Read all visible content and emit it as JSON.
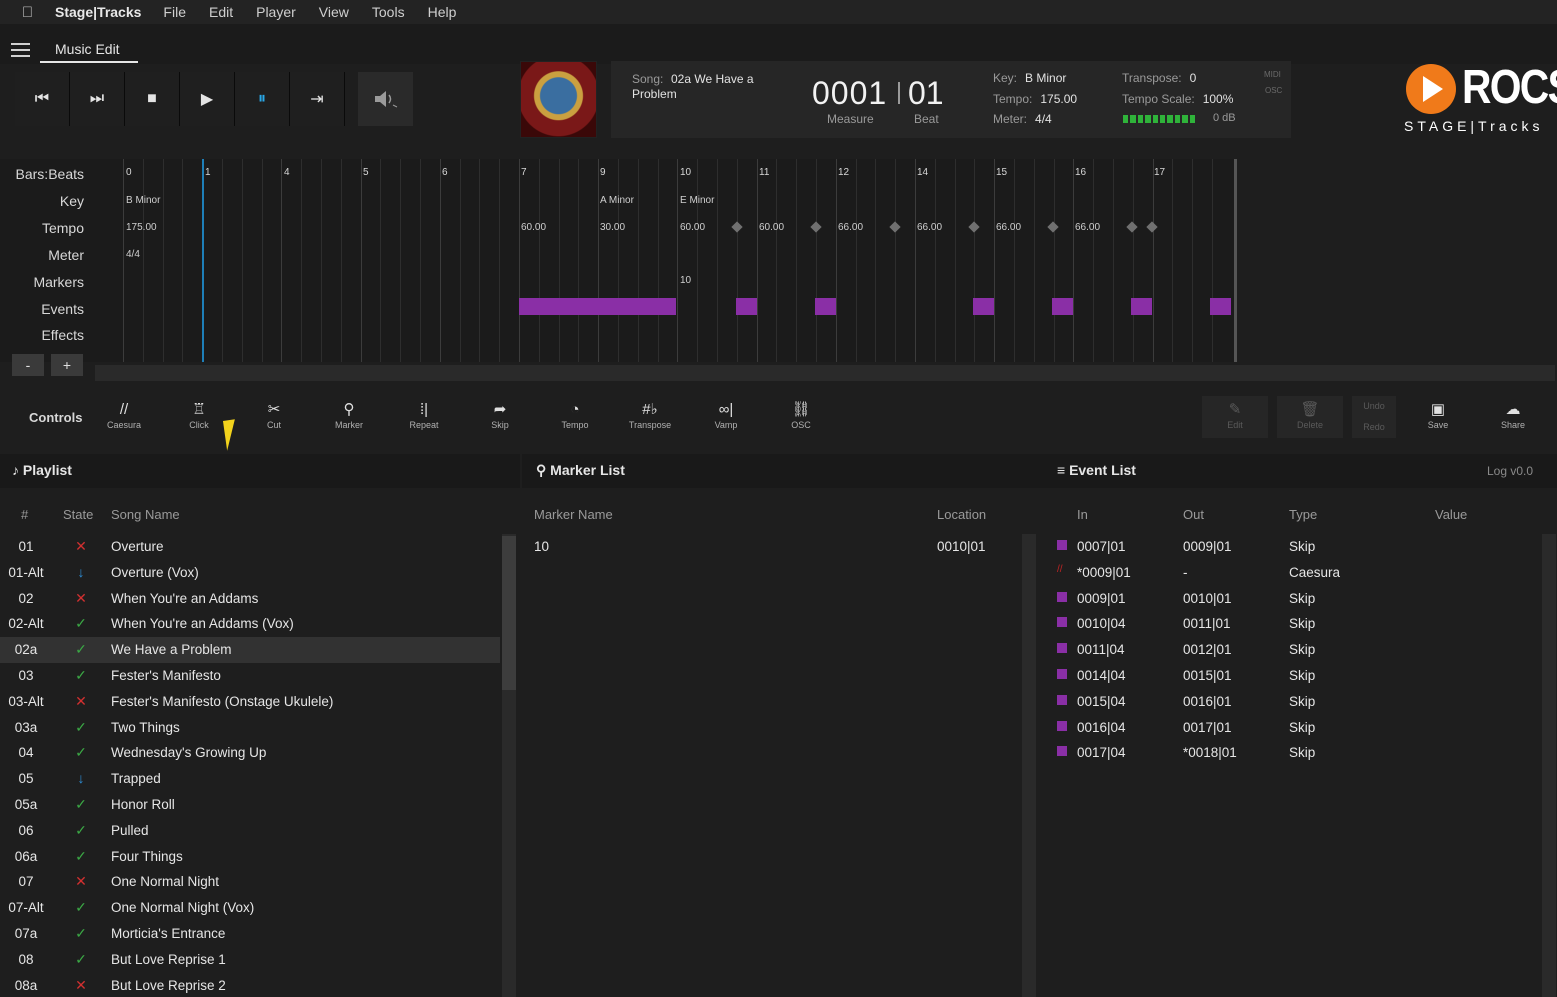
{
  "menubar": {
    "apple": "",
    "app_name": "Stage|Tracks",
    "items": [
      "File",
      "Edit",
      "Player",
      "View",
      "Tools",
      "Help"
    ]
  },
  "tabs": {
    "active": "Music Edit"
  },
  "transport": {
    "buttons": [
      {
        "icon": "skip-back-icon",
        "glyph": "⏮"
      },
      {
        "icon": "next-icon",
        "glyph": "⏭"
      },
      {
        "icon": "stop-icon",
        "glyph": "■"
      },
      {
        "icon": "play-icon",
        "glyph": "▶"
      },
      {
        "icon": "pause-icon",
        "glyph": "⏸"
      },
      {
        "icon": "skip-end-icon",
        "glyph": "⇥"
      }
    ],
    "volume_icon": "speaker-icon"
  },
  "info": {
    "song_label": "Song:",
    "song_name_1": "02a We Have a",
    "song_name_2": "Problem",
    "measure": "0001",
    "beat": "01",
    "measure_label": "Measure",
    "beat_label": "Beat",
    "key_label": "Key:",
    "key": "B Minor",
    "tempo_label": "Tempo:",
    "tempo": "175.00",
    "meter_label": "Meter:",
    "meter": "4/4",
    "transpose_label": "Transpose:",
    "transpose": "0",
    "tempo_scale_label": "Tempo Scale:",
    "tempo_scale": "100%",
    "db": "0 dB",
    "midi": "MIDI",
    "osc": "OSC",
    "level_fraction": 1.0
  },
  "logo": {
    "word": "ROCS",
    "sub": "STAGE|Tracks",
    "color": "#f07a1a"
  },
  "timeline": {
    "row_labels": [
      "Bars:Beats",
      "Key",
      "Tempo",
      "Meter",
      "Markers",
      "Events",
      "Effects"
    ],
    "bars": [
      "0",
      "1",
      "4",
      "5",
      "6",
      "7",
      "9",
      "10",
      "11",
      "12",
      "14",
      "15",
      "16",
      "17"
    ],
    "keys": [
      "B Minor",
      "A Minor",
      "E Minor"
    ],
    "tempos": [
      "175.00",
      "60.00",
      "30.00",
      "60.00",
      "60.00",
      "66.00",
      "66.00",
      "66.00",
      "66.00"
    ],
    "meter": "4/4",
    "marker": "10",
    "zoom_out": "-",
    "zoom_in": "+"
  },
  "controls": {
    "label": "Controls",
    "tools": [
      {
        "label": "Caesura",
        "icon": "caesura-icon",
        "glyph": "//"
      },
      {
        "label": "Click",
        "icon": "metronome-icon",
        "glyph": "♖"
      },
      {
        "label": "Cut",
        "icon": "scissors-icon",
        "glyph": "✂"
      },
      {
        "label": "Marker",
        "icon": "map-pin-icon",
        "glyph": "⚲"
      },
      {
        "label": "Repeat",
        "icon": "repeat-icon",
        "glyph": "⁞|"
      },
      {
        "label": "Skip",
        "icon": "skip-arrow-icon",
        "glyph": "➦"
      },
      {
        "label": "Tempo",
        "icon": "gauge-icon",
        "glyph": "◔"
      },
      {
        "label": "Transpose",
        "icon": "transpose-icon",
        "glyph": "#♭"
      },
      {
        "label": "Vamp",
        "icon": "vamp-icon",
        "glyph": "∞|"
      },
      {
        "label": "OSC",
        "icon": "network-icon",
        "glyph": "⛓"
      }
    ],
    "right": [
      {
        "label": "Edit",
        "icon": "pencil-icon",
        "glyph": "✎"
      },
      {
        "label": "Delete",
        "icon": "trash-icon",
        "glyph": "🗑"
      },
      {
        "label": "Save",
        "icon": "save-icon",
        "glyph": "▣"
      },
      {
        "label": "Share",
        "icon": "cloud-upload-icon",
        "glyph": "☁"
      }
    ],
    "undo": "Undo",
    "redo": "Redo"
  },
  "playlist": {
    "title": "Playlist",
    "headers": [
      "#",
      "State",
      "Song Name"
    ],
    "rows": [
      {
        "num": "01",
        "state": "x",
        "name": "Overture"
      },
      {
        "num": "01-Alt",
        "state": "dl",
        "name": "Overture (Vox)"
      },
      {
        "num": "02",
        "state": "x",
        "name": "When You're an Addams"
      },
      {
        "num": "02-Alt",
        "state": "ok",
        "name": "When You're an Addams (Vox)"
      },
      {
        "num": "02a",
        "state": "ok",
        "name": "We Have a Problem"
      },
      {
        "num": "03",
        "state": "ok",
        "name": "Fester's Manifesto"
      },
      {
        "num": "03-Alt",
        "state": "x",
        "name": "Fester's Manifesto (Onstage Ukulele)"
      },
      {
        "num": "03a",
        "state": "ok",
        "name": "Two Things"
      },
      {
        "num": "04",
        "state": "ok",
        "name": "Wednesday's Growing Up"
      },
      {
        "num": "05",
        "state": "dl",
        "name": "Trapped"
      },
      {
        "num": "05a",
        "state": "ok",
        "name": "Honor Roll"
      },
      {
        "num": "06",
        "state": "ok",
        "name": "Pulled"
      },
      {
        "num": "06a",
        "state": "ok",
        "name": "Four Things"
      },
      {
        "num": "07",
        "state": "x",
        "name": "One Normal Night"
      },
      {
        "num": "07-Alt",
        "state": "ok",
        "name": "One Normal Night (Vox)"
      },
      {
        "num": "07a",
        "state": "ok",
        "name": "Morticia's Entrance"
      },
      {
        "num": "08",
        "state": "ok",
        "name": "But Love Reprise 1"
      },
      {
        "num": "08a",
        "state": "x",
        "name": "But Love Reprise 2"
      }
    ]
  },
  "markers": {
    "title": "Marker List",
    "headers": [
      "Marker Name",
      "Location"
    ],
    "rows": [
      {
        "name": "10",
        "location": "0010|01"
      }
    ]
  },
  "events": {
    "title": "Event List",
    "log": "Log v0.0",
    "headers": [
      "In",
      "Out",
      "Type",
      "Value"
    ],
    "rows": [
      {
        "in": "0007|01",
        "out": "0009|01",
        "type": "Skip",
        "kind": "skip"
      },
      {
        "in": "*0009|01",
        "out": "-",
        "type": "Caesura",
        "kind": "caesura"
      },
      {
        "in": "0009|01",
        "out": "0010|01",
        "type": "Skip",
        "kind": "skip"
      },
      {
        "in": "0010|04",
        "out": "0011|01",
        "type": "Skip",
        "kind": "skip"
      },
      {
        "in": "0011|04",
        "out": "0012|01",
        "type": "Skip",
        "kind": "skip"
      },
      {
        "in": "0014|04",
        "out": "0015|01",
        "type": "Skip",
        "kind": "skip"
      },
      {
        "in": "0015|04",
        "out": "0016|01",
        "type": "Skip",
        "kind": "skip"
      },
      {
        "in": "0016|04",
        "out": "0017|01",
        "type": "Skip",
        "kind": "skip"
      },
      {
        "in": "0017|04",
        "out": "*0018|01",
        "type": "Skip",
        "kind": "skip"
      }
    ],
    "color": "#8a2fa6"
  }
}
